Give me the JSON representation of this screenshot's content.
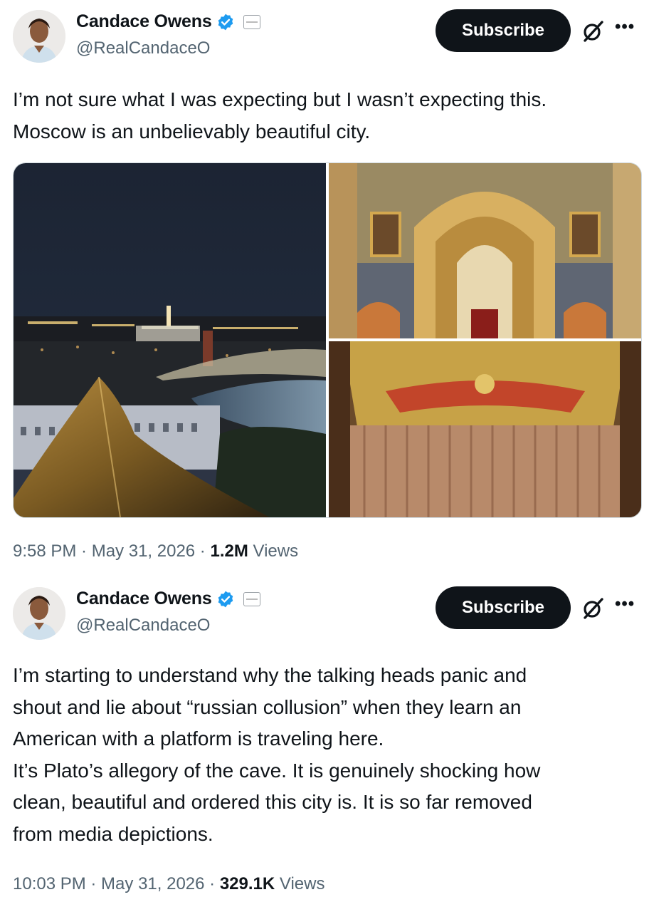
{
  "tweets": [
    {
      "author": {
        "display_name": "Candace Owens",
        "handle": "@RealCandaceO",
        "verified": true,
        "affiliate_badge": "DailyWire"
      },
      "subscribe_label": "Subscribe",
      "text": "I’m not sure what I was expecting but I wasn’t expecting this.\nMoscow is an unbelievably beautiful city.",
      "media": [
        {
          "icon": "night-city-river-photo"
        },
        {
          "icon": "cathedral-interior-photo"
        },
        {
          "icon": "theater-curtain-photo"
        }
      ],
      "timestamp": "9:58 PM · May 31, 2026 · ",
      "views_count": "1.2M",
      "views_label": " Views"
    },
    {
      "author": {
        "display_name": "Candace Owens",
        "handle": "@RealCandaceO",
        "verified": true,
        "affiliate_badge": "DailyWire"
      },
      "subscribe_label": "Subscribe",
      "text": "I’m starting to understand why the talking heads panic and\nshout and lie about “russian collusion” when they learn an\nAmerican with a platform is traveling here.\nIt’s Plato’s allegory of the cave. It is genuinely shocking how\nclean, beautiful and ordered this city is. It is so far removed\nfrom media depictions.",
      "timestamp": "10:03 PM · May 31, 2026 · ",
      "views_count": "329.1K",
      "views_label": " Views"
    }
  ],
  "colors": {
    "text_primary": "#0f1419",
    "text_secondary": "#536471",
    "verified_blue": "#1d9bf0",
    "subscribe_bg": "#0f1419"
  },
  "icons": [
    "verified-icon",
    "grok-icon",
    "more-icon"
  ]
}
